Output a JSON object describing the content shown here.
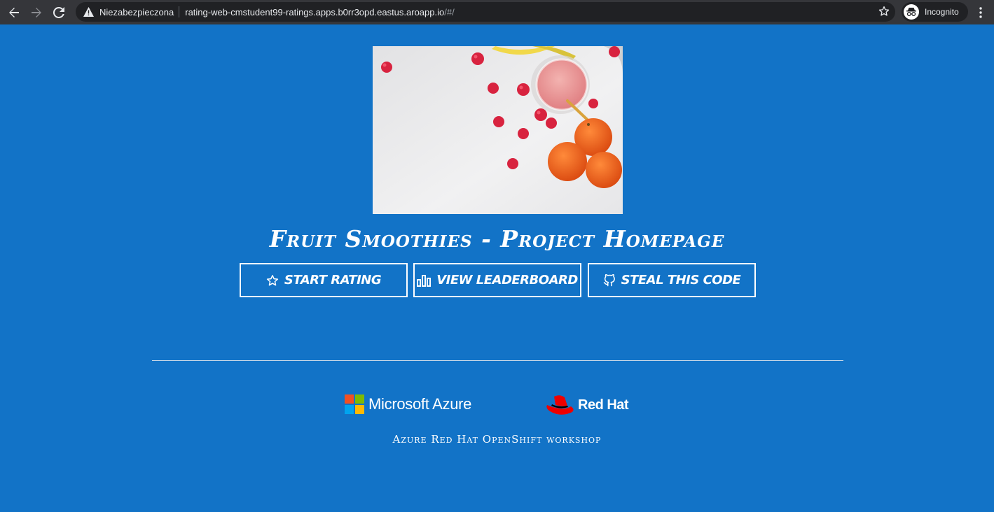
{
  "browser": {
    "security_label": "Niezabezpieczona",
    "url_host": "rating-web-cmstudent99-ratings.apps.b0rr3opd.eastus.aroapp.io",
    "url_path": "/#/",
    "profile_label": "Incognito"
  },
  "hero": {
    "image": "fruit-smoothie-photo"
  },
  "page": {
    "title": "Fruit Smoothies - Project Homepage",
    "buttons": [
      {
        "label": "Start Rating",
        "icon": "star-icon"
      },
      {
        "label": "View Leaderboard",
        "icon": "bar-chart-icon"
      },
      {
        "label": "Steal this code",
        "icon": "github-icon"
      }
    ]
  },
  "footer": {
    "azure_label": "Microsoft Azure",
    "redhat_label": "Red Hat",
    "workshop_text": "Azure Red Hat OpenShift workshop"
  },
  "colors": {
    "page_background": "#1273c7",
    "chrome_background": "#35363a",
    "omnibox_background": "#202124"
  }
}
